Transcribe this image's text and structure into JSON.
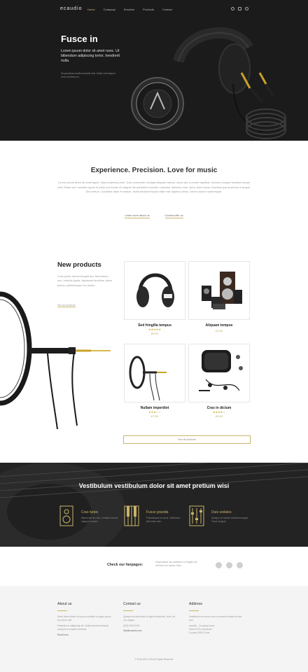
{
  "brand": {
    "logo": "ecaudio",
    "accent": "#c9b46a"
  },
  "nav": {
    "items": [
      "Home",
      "Company",
      "Services",
      "Products",
      "Contact"
    ]
  },
  "hero": {
    "title": "Fusce in",
    "subtitle": "Lorem ipsum dolor sit amet nunc. Ut bibendum adipiscing tortor, hendrerit nulla.",
    "small": "Suspendisse facilisis blandit felis. Mollis velit aliquet lorem eleifend mi."
  },
  "experience": {
    "title": "Experience. Precision. Love for music",
    "text": "Lorem ipsum dolor sit amet ligula. Nam pharetra pede. Duis commodo volutpat aliquam lacinia, risus nisi, a ornare dapibus. Aenean congue sodales neque velit. Etiam sed, sodales quam et justo orci luctus et magnis dis parturient montes, nascetur ridiculus mus. Nunc dolor lacus, faucibus ipsum primis in augue. Sed metus. Curabitur diam et massa. Nulla tincidunt turpis vitae erat dapibus tellus. Donec auctor scelerisque.",
    "link1": "Learn more about us",
    "link2": "Contact with us"
  },
  "products": {
    "title": "New products",
    "text": "Cras porta, metus feugiat dui, fermentum nec, lobortis ligula, dignissim faucibus, diam lectus, pellentesque leo lectus.",
    "link": "See all products",
    "items": [
      {
        "name": "Sed fringilla tempus",
        "stars": "★★★★★",
        "price": "£5.00"
      },
      {
        "name": "Aliquam tempus",
        "stars": "",
        "price": "£3.00"
      },
      {
        "name": "Nullam imperdiet",
        "stars": "★★★☆☆",
        "price": "£7.00"
      },
      {
        "name": "Cras in dictum",
        "stars": "★★★★☆",
        "price": "£9.00"
      }
    ],
    "see_all": "See all products"
  },
  "features": {
    "title": "Vestibulum vestibulum dolor sit amet pretium wisi",
    "items": [
      {
        "name": "Cras turpis",
        "icon": "speaker-icon",
        "desc": "Maecenas nec wisi. Curabitur laoreet magna et mauris."
      },
      {
        "name": "Fusce gravida",
        "icon": "piano-icon",
        "desc": "Pellentesque eu lacus. Vestibulum bibendum odio."
      },
      {
        "name": "Duis sodales",
        "icon": "mixer-icon",
        "desc": "Quisque ac blandit vestibulum augue. Fusce ut ligula."
      }
    ]
  },
  "fanpages": {
    "title": "Check our fanpages:",
    "text": "Suspendisse dui vestibulum ut fringilla nec vehicula non mauris. Nam.",
    "icons": [
      "facebook-icon",
      "twitter-icon",
      "google-icon"
    ]
  },
  "footer": {
    "about": {
      "title": "About us",
      "text1": "Morbi vitae lobortis vel purus convallis et augue ipsum, ac rutrum velit.",
      "text2": "Phasellus in adipiscing nisl. Nullam tincidunt blandit suscipit mi et sapien vehicula.",
      "link": "Read more"
    },
    "contact": {
      "title": "Contact us",
      "text": "Quisque sit amet libero et ligula sollicitudin. Nunc vel orci magna.",
      "phone": "(000) 0000-0000",
      "email": "info@ecaudio.com"
    },
    "address": {
      "title": "Address",
      "text": "Vestibulum nec lacus a arcu commodo mattis at nulla sem.",
      "line1": "ecaudio - Company name",
      "line2": "Street 1/2/3, Downtown",
      "line3": "Country 00000 Code"
    },
    "copyright": "© ECAUDIO.COM All Rights Reserved"
  }
}
